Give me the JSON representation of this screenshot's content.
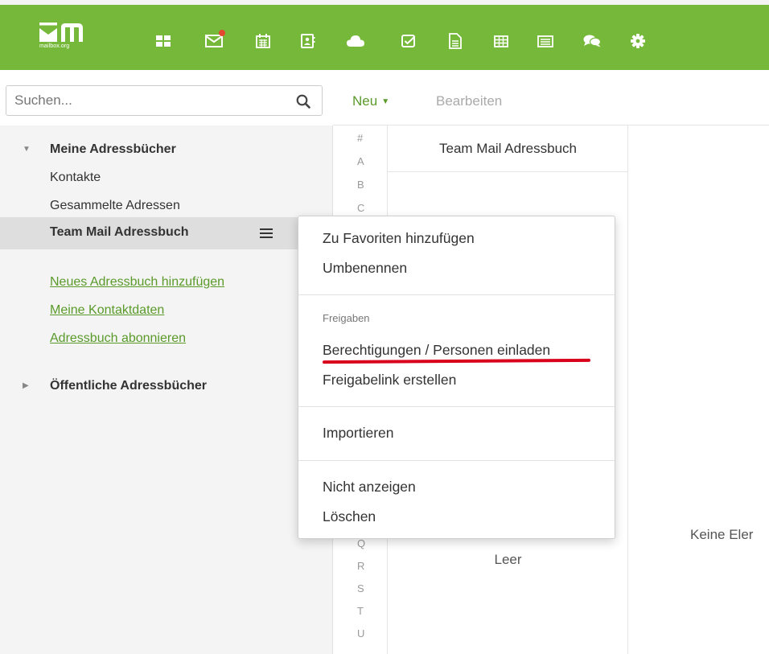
{
  "app": {
    "logo_text": "mailbox.org",
    "brand_color": "#76b93a",
    "accent_color": "#5a9a2a"
  },
  "apps_bar": [
    {
      "name": "launcher-grid-icon"
    },
    {
      "name": "mail-icon",
      "badge_color": "#e2472f"
    },
    {
      "name": "calendar-icon"
    },
    {
      "name": "addressbook-icon"
    },
    {
      "name": "cloud-icon"
    },
    {
      "name": "tasks-icon"
    },
    {
      "name": "document-icon"
    },
    {
      "name": "spreadsheet-icon"
    },
    {
      "name": "presentation-icon"
    },
    {
      "name": "chat-icon"
    },
    {
      "name": "gear-icon"
    }
  ],
  "search": {
    "placeholder": "Suchen..."
  },
  "toolbar": {
    "new_label": "Neu",
    "edit_label": "Bearbeiten"
  },
  "sidebar": {
    "my_folder": "Meine Adressbücher",
    "items": [
      "Kontakte",
      "Gesammelte Adressen"
    ],
    "selected_item": "Team Mail Adressbuch",
    "links": [
      "Neues Adressbuch hinzufügen",
      "Meine Kontaktdaten",
      "Adressbuch abonnieren"
    ],
    "public_folder": "Öffentliche Adressbücher"
  },
  "alphabet": {
    "top": [
      "#",
      "A",
      "B",
      "C"
    ],
    "bottom": [
      "Q",
      "R",
      "S",
      "T",
      "U"
    ]
  },
  "list": {
    "header": "Team Mail Adressbuch",
    "empty_label": "Leer"
  },
  "detail": {
    "empty_label": "Keine Eler"
  },
  "context_menu": {
    "add_favorite": "Zu Favoriten hinzufügen",
    "rename": "Umbenennen",
    "sharing_header": "Freigaben",
    "permissions": "Berechtigungen / Personen einladen",
    "create_share_link": "Freigabelink erstellen",
    "import": "Importieren",
    "hide": "Nicht anzeigen",
    "delete": "Löschen",
    "highlight_color": "#d9001b"
  }
}
